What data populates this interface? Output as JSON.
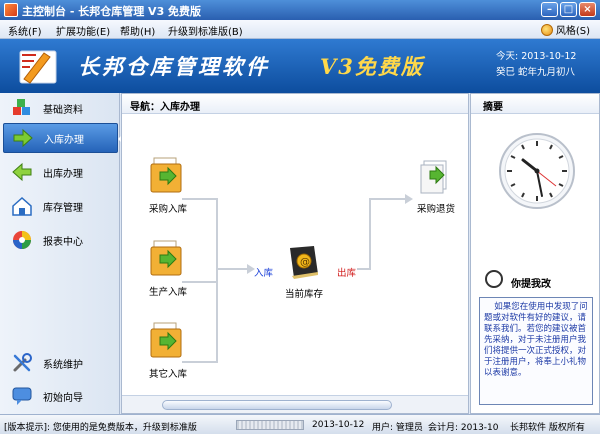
{
  "window": {
    "title": "主控制台 - 长邦仓库管理 V3 免费版"
  },
  "menubar": {
    "items": [
      "系统(F)",
      "扩展功能(E)",
      "帮助(H)",
      "升级到标准版(B)"
    ],
    "style_label": "风格(S)"
  },
  "banner": {
    "app_title": "长邦仓库管理软件",
    "version": "V3免费版",
    "date_line": "今天: 2013-10-12",
    "lunar_line": "癸巳 蛇年九月初八"
  },
  "sidebar": {
    "items": [
      {
        "label": "基础资料",
        "icon": "blocks-icon",
        "active": false
      },
      {
        "label": "入库办理",
        "icon": "arrow-right-icon",
        "active": true
      },
      {
        "label": "出库办理",
        "icon": "arrow-left-icon",
        "active": false
      },
      {
        "label": "库存管理",
        "icon": "house-icon",
        "active": false
      },
      {
        "label": "报表中心",
        "icon": "color-wheel-icon",
        "active": false
      },
      {
        "label": "系统维护",
        "icon": "tools-icon",
        "active": false
      },
      {
        "label": "初始向导",
        "icon": "chat-icon",
        "active": false
      }
    ]
  },
  "main": {
    "breadcrumb": "导航：入库办理",
    "flow": {
      "purchase_in": "采购入库",
      "production_in": "生产入库",
      "other_in": "其它入库",
      "in_label": "入库",
      "stock": "当前库存",
      "out_label": "出库",
      "purchase_return": "采购退货"
    }
  },
  "rightpanel": {
    "title": "摘要",
    "tips_title": "你提我改",
    "tips_text": "如果您在使用中发现了问题或对软件有好的建议，请联系我们。若您的建议被首先采纳，对于未注册用户我们将提供一次正式授权，对于注册用户，将奉上小礼物以表谢意。"
  },
  "statusbar": {
    "notice": "[版本提示]: 您使用的是免费版本，升级到标准版",
    "date": "2013-10-12",
    "user": "用户: 管理员",
    "accounting": "会计月: 2013-10",
    "company": "长邦软件 版权所有"
  }
}
